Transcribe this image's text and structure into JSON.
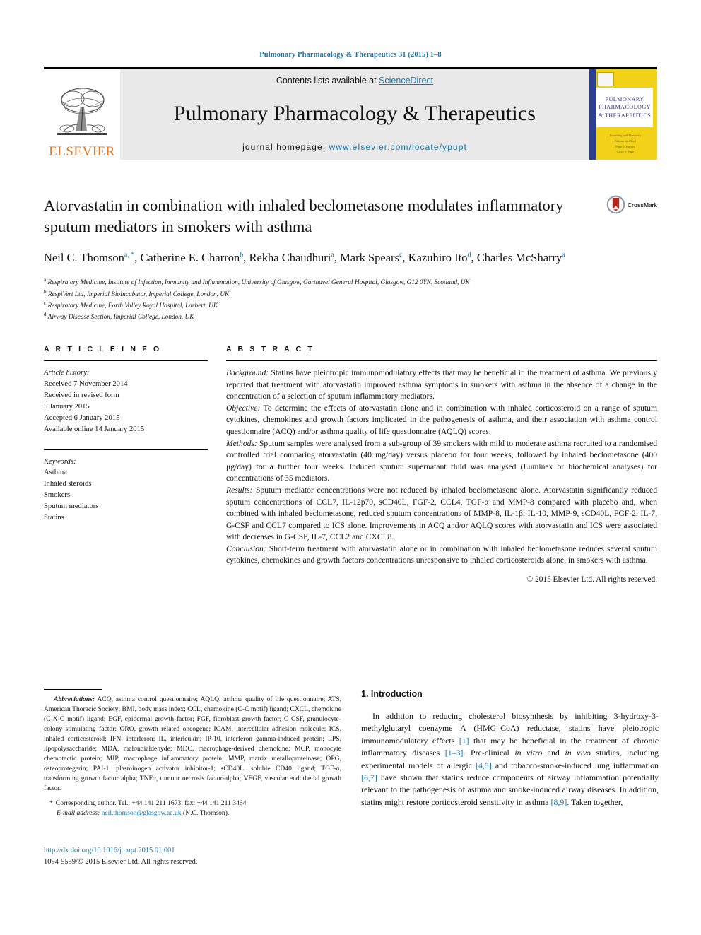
{
  "header": {
    "running_head": "Pulmonary Pharmacology & Therapeutics 31 (2015) 1–8",
    "contents_prefix": "Contents lists available at ",
    "sciencedirect": "ScienceDirect",
    "journal_title": "Pulmonary Pharmacology & Therapeutics",
    "homepage_label": "journal homepage: ",
    "homepage_url": "www.elsevier.com/locate/ypupt",
    "publisher": "ELSEVIER",
    "cover": {
      "line1": "PULMONARY",
      "line2": "PHARMACOLOGY",
      "line3": "& THERAPEUTICS",
      "sub1": "Founding and Honorary",
      "sub2": "Editors-in-Chief",
      "sub3": "Peter J. Barnes",
      "sub4": "Clive P. Page"
    }
  },
  "title": {
    "text": "Atorvastatin in combination with inhaled beclometasone modulates inflammatory sputum mediators in smokers with asthma",
    "crossmark_label": "CrossMark"
  },
  "authors": {
    "list": [
      {
        "name": "Neil C. Thomson",
        "marks": "a, *"
      },
      {
        "name": "Catherine E. Charron",
        "marks": "b"
      },
      {
        "name": "Rekha Chaudhuri",
        "marks": "a"
      },
      {
        "name": "Mark Spears",
        "marks": "c"
      },
      {
        "name": "Kazuhiro Ito",
        "marks": "d"
      },
      {
        "name": "Charles McSharry",
        "marks": "a"
      }
    ],
    "affiliations": [
      {
        "mark": "a",
        "text": "Respiratory Medicine, Institute of Infection, Immunity and Inflammation, University of Glasgow, Gartnavel General Hospital, Glasgow, G12 0YN, Scotland, UK"
      },
      {
        "mark": "b",
        "text": "RespiVert Ltd, Imperial BioIncubator, Imperial College, London, UK"
      },
      {
        "mark": "c",
        "text": "Respiratory Medicine, Forth Valley Royal Hospital, Larbert, UK"
      },
      {
        "mark": "d",
        "text": "Airway Disease Section, Imperial College, London, UK"
      }
    ]
  },
  "article_info": {
    "heading": "A R T I C L E   I N F O",
    "history_label": "Article history:",
    "history_lines": [
      "Received 7 November 2014",
      "Received in revised form",
      "5 January 2015",
      "Accepted 6 January 2015",
      "Available online 14 January 2015"
    ],
    "keywords_label": "Keywords:",
    "keywords": [
      "Asthma",
      "Inhaled steroids",
      "Smokers",
      "Sputum mediators",
      "Statins"
    ]
  },
  "abstract": {
    "heading": "A B S T R A C T",
    "sections": [
      {
        "label": "Background:",
        "text": " Statins have pleiotropic immunomodulatory effects that may be beneficial in the treatment of asthma. We previously reported that treatment with atorvastatin improved asthma symptoms in smokers with asthma in the absence of a change in the concentration of a selection of sputum inflammatory mediators."
      },
      {
        "label": "Objective:",
        "text": " To determine the effects of atorvastatin alone and in combination with inhaled corticosteroid on a range of sputum cytokines, chemokines and growth factors implicated in the pathogenesis of asthma, and their association with asthma control questionnaire (ACQ) and/or asthma quality of life questionnaire (AQLQ) scores."
      },
      {
        "label": "Methods:",
        "text": " Sputum samples were analysed from a sub-group of 39 smokers with mild to moderate asthma recruited to a randomised controlled trial comparing atorvastatin (40 mg/day) versus placebo for four weeks, followed by inhaled beclometasone (400 μg/day) for a further four weeks. Induced sputum supernatant fluid was analysed (Luminex or biochemical analyses) for concentrations of 35 mediators."
      },
      {
        "label": "Results:",
        "text": " Sputum mediator concentrations were not reduced by inhaled beclometasone alone. Atorvastatin significantly reduced sputum concentrations of CCL7, IL-12p70, sCD40L, FGF-2, CCL4, TGF-α and MMP-8 compared with placebo and, when combined with inhaled beclometasone, reduced sputum concentrations of MMP-8, IL-1β, IL-10, MMP-9, sCD40L, FGF-2, IL-7, G-CSF and CCL7 compared to ICS alone. Improvements in ACQ and/or AQLQ scores with atorvastatin and ICS were associated with decreases in G-CSF, IL-7, CCL2 and CXCL8."
      },
      {
        "label": "Conclusion:",
        "text": " Short-term treatment with atorvastatin alone or in combination with inhaled beclometasone reduces several sputum cytokines, chemokines and growth factors concentrations unresponsive to inhaled corticosteroids alone, in smokers with asthma."
      }
    ],
    "copyright": "© 2015 Elsevier Ltd. All rights reserved."
  },
  "abbreviations": {
    "label": "Abbreviations:",
    "text": " ACQ, asthma control questionnaire; AQLQ, asthma quality of life questionnaire; ATS, American Thoracic Society; BMI, body mass index; CCL, chemokine (C-C motif) ligand; CXCL, chemokine (C-X-C motif) ligand; EGF, epidermal growth factor; FGF, fibroblast growth factor; G-CSF, granulocyte-colony stimulating factor; GRO, growth related oncogene; ICAM, intercellular adhesion molecule; ICS, inhaled corticosteroid; IFN, interferon; IL, interleukin; IP-10, interferon gamma-induced protein; LPS, lipopolysaccharide; MDA, malondialdehyde; MDC, macrophage-derived chemokine; MCP, monocyte chemotactic protein; MIP, macrophage inflammatory protein; MMP, matrix metalloproteinase; OPG, osteoprotegerin; PAI-1, plasminogen activator inhibitor-1; sCD40L, soluble CD40 ligand; TGF-α, transforming growth factor alpha; TNFα, tumour necrosis factor-alpha; VEGF, vascular endothelial growth factor."
  },
  "corresponding": {
    "star": "*",
    "line1": "Corresponding author. Tel.: +44 141 211 1673; fax: +44 141 211 3464.",
    "email_label": "E-mail address:",
    "email": "neil.thomson@glasgow.ac.uk",
    "email_suffix": " (N.C. Thomson)."
  },
  "introduction": {
    "heading": "1. Introduction",
    "paragraph_parts": [
      {
        "t": "In addition to reducing cholesterol biosynthesis by inhibiting 3-hydroxy-3-methylglutaryl coenzyme A (HMG–CoA) reductase, statins have pleiotropic immunomodulatory effects ",
        "k": "plain"
      },
      {
        "t": "[1]",
        "k": "ref"
      },
      {
        "t": " that may be beneficial in the treatment of chronic inflammatory diseases ",
        "k": "plain"
      },
      {
        "t": "[1–3]",
        "k": "ref"
      },
      {
        "t": ". Pre-clinical ",
        "k": "plain"
      },
      {
        "t": "in vitro",
        "k": "italic"
      },
      {
        "t": " and ",
        "k": "plain"
      },
      {
        "t": "in vivo",
        "k": "italic"
      },
      {
        "t": " studies, including experimental models of allergic ",
        "k": "plain"
      },
      {
        "t": "[4,5]",
        "k": "ref"
      },
      {
        "t": " and tobacco-smoke-induced lung inflammation ",
        "k": "plain"
      },
      {
        "t": "[6,7]",
        "k": "ref"
      },
      {
        "t": " have shown that statins reduce components of airway inflammation potentially relevant to the pathogenesis of asthma and smoke-induced airway diseases. In addition, statins might restore corticosteroid sensitivity in asthma ",
        "k": "plain"
      },
      {
        "t": "[8,9]",
        "k": "ref"
      },
      {
        "t": ". Taken together,",
        "k": "plain"
      }
    ]
  },
  "footer": {
    "doi": "http://dx.doi.org/10.1016/j.pupt.2015.01.001",
    "issn": "1094-5539/© 2015 Elsevier Ltd. All rights reserved."
  },
  "colors": {
    "link": "#1b76a8",
    "elsevier_orange": "#E87722",
    "cover_yellow": "#F2D218",
    "band_grey": "#e9e9e9"
  }
}
